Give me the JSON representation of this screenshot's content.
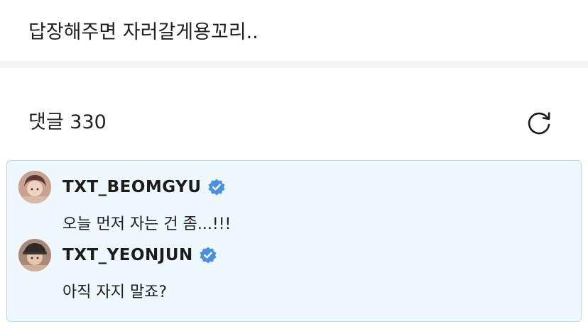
{
  "post": {
    "text": "답장해주면 자러갈게용꼬리.."
  },
  "comments_header": {
    "label": "댓글 330",
    "refresh_icon": "refresh-icon"
  },
  "comments": [
    {
      "author": "TXT_BEOMGYU",
      "verified": true,
      "text": "오늘 먼저 자는 건 좀...!!!"
    },
    {
      "author": "TXT_YEONJUN",
      "verified": true,
      "text": "아직 자지 말죠?"
    }
  ],
  "colors": {
    "card_background": "#eef7fc",
    "card_border": "#b9dcee",
    "verified_badge": "#4a90e2",
    "divider_band": "#f4f5f7"
  }
}
